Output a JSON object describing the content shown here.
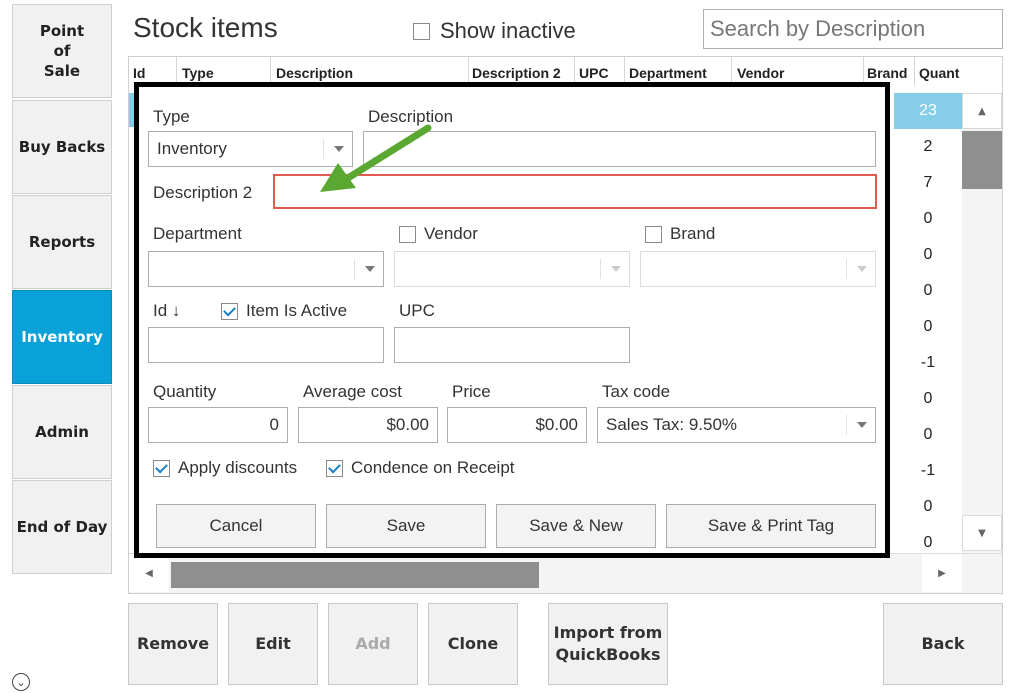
{
  "sidebar": {
    "items": [
      {
        "label": "Point\nof\nSale",
        "active": false
      },
      {
        "label": "Buy Backs",
        "active": false
      },
      {
        "label": "Reports",
        "active": false
      },
      {
        "label": "Inventory",
        "active": true
      },
      {
        "label": "Admin",
        "active": false
      },
      {
        "label": "End of Day",
        "active": false
      }
    ],
    "expand_icon": "chevron-down-circle-icon"
  },
  "header": {
    "title": "Stock items",
    "show_inactive_label": "Show inactive",
    "show_inactive_checked": false,
    "search_placeholder": "Search by Description"
  },
  "table": {
    "columns": [
      "Id",
      "Type",
      "Description",
      "Description 2",
      "UPC",
      "Department",
      "Vendor",
      "Brand",
      "Quant"
    ],
    "quantities": [
      "23",
      "2",
      "7",
      "0",
      "0",
      "0",
      "0",
      "-1",
      "0",
      "0",
      "-1",
      "0",
      "0"
    ],
    "selected_index": 0
  },
  "form": {
    "type_label": "Type",
    "type_value": "Inventory",
    "description_label": "Description",
    "description_value": "",
    "description2_label": "Description 2",
    "description2_value": "",
    "department_label": "Department",
    "vendor_label": "Vendor",
    "vendor_checked": false,
    "brand_label": "Brand",
    "brand_checked": false,
    "id_label": "Id ↓",
    "item_active_label": "Item Is Active",
    "item_active_checked": true,
    "upc_label": "UPC",
    "quantity_label": "Quantity",
    "quantity_value": "0",
    "avg_cost_label": "Average cost",
    "avg_cost_value": "$0.00",
    "price_label": "Price",
    "price_value": "$0.00",
    "tax_code_label": "Tax code",
    "tax_code_value": "Sales Tax: 9.50%",
    "apply_discounts_label": "Apply discounts",
    "apply_discounts_checked": true,
    "condence_label": "Condence on Receipt",
    "condence_checked": true,
    "buttons": {
      "cancel": "Cancel",
      "save": "Save",
      "save_new": "Save & New",
      "save_print": "Save & Print Tag"
    }
  },
  "bottom_buttons": {
    "remove": "Remove",
    "edit": "Edit",
    "add": "Add",
    "clone": "Clone",
    "import": "Import from\nQuickBooks",
    "back": "Back"
  },
  "colors": {
    "accent": "#09a1d8",
    "selected_row": "#86cdea",
    "highlight_border": "#e05a4f",
    "annotation_arrow": "#5aa832"
  }
}
